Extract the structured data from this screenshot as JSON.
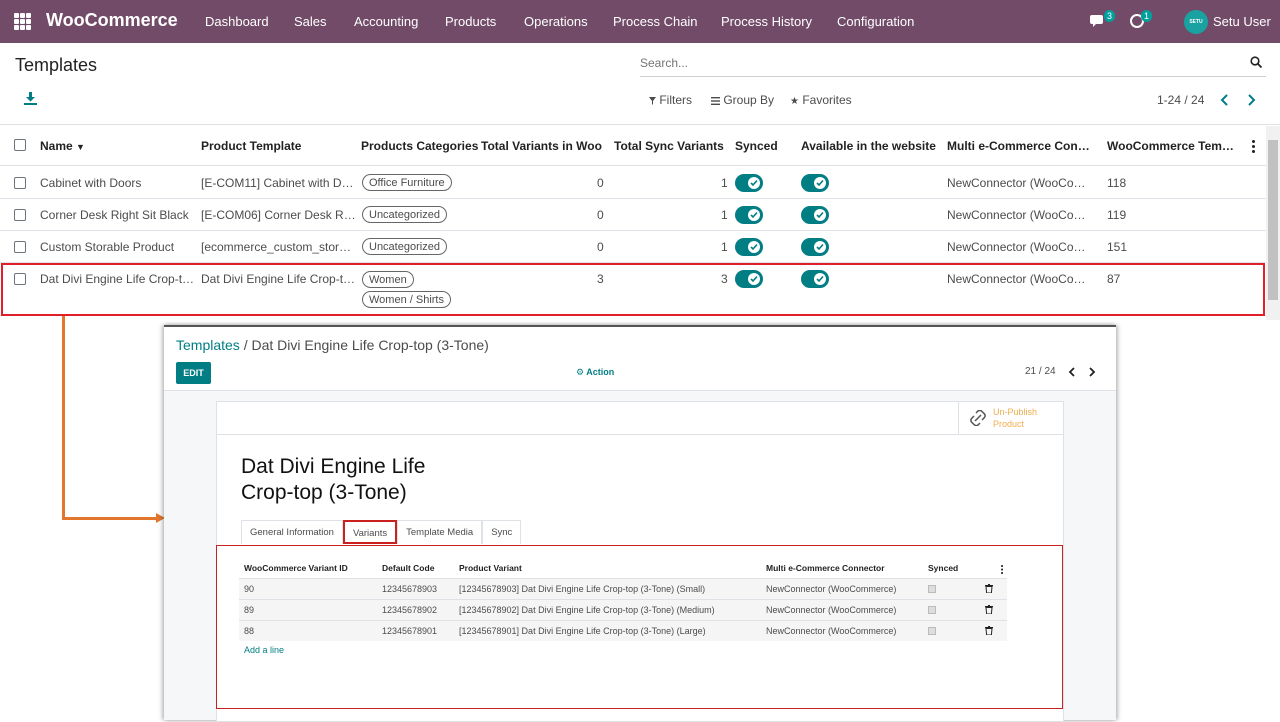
{
  "navbar": {
    "brand": "WooCommerce",
    "menu": [
      "Dashboard",
      "Sales",
      "Accounting",
      "Products",
      "Operations",
      "Process Chain",
      "Process History",
      "Configuration"
    ],
    "chat_count": "3",
    "activity_count": "1",
    "avatar_text": "SETU",
    "user_name": "Setu User"
  },
  "control_panel": {
    "title": "Templates",
    "search_placeholder": "Search...",
    "filters_label": "Filters",
    "group_by_label": "Group By",
    "favorites_label": "Favorites",
    "pager": "1-24 / 24"
  },
  "list": {
    "columns": [
      "Name",
      "Product Template",
      "Products Categories",
      "Total Variants in Woo",
      "Total Sync Variants",
      "Synced",
      "Available in the website",
      "Multi e-Commerce Conn…",
      "WooCommerce Temp…"
    ],
    "rows": [
      {
        "name": "Cabinet with Doors",
        "template": "[E-COM11] Cabinet with D…",
        "categories": [
          "Office Furniture"
        ],
        "total_variants": "0",
        "sync_variants": "1",
        "connector": "NewConnector (WooCom…",
        "woo_id": "118"
      },
      {
        "name": "Corner Desk Right Sit Black",
        "template": "[E-COM06] Corner Desk Ri…",
        "categories": [
          "Uncategorized"
        ],
        "total_variants": "0",
        "sync_variants": "1",
        "connector": "NewConnector (WooCom…",
        "woo_id": "119"
      },
      {
        "name": "Custom Storable Product",
        "template": "[ecommerce_custom_stor…",
        "categories": [
          "Uncategorized"
        ],
        "total_variants": "0",
        "sync_variants": "1",
        "connector": "NewConnector (WooCom…",
        "woo_id": "151"
      },
      {
        "name": "Dat Divi Engine Life Crop-t…",
        "template": "Dat Divi Engine Life Crop-t…",
        "categories": [
          "Women",
          "Women / Shirts"
        ],
        "total_variants": "3",
        "sync_variants": "3",
        "connector": "NewConnector (WooCom…",
        "woo_id": "87"
      }
    ]
  },
  "form": {
    "breadcrumb_parent": "Templates",
    "breadcrumb_sep": " / ",
    "breadcrumb_current": "Dat Divi Engine Life Crop-top (3-Tone)",
    "edit_label": "EDIT",
    "action_label": "Action",
    "pager": "21 / 24",
    "unpublish_label": "Un-Publish Product",
    "title_line1": "Dat Divi Engine Life",
    "title_line2": "Crop-top (3-Tone)",
    "tabs": [
      "General Information",
      "Variants",
      "Template Media",
      "Sync"
    ],
    "variant_columns": [
      "WooCommerce Variant ID",
      "Default Code",
      "Product Variant",
      "Multi e-Commerce Connector",
      "Synced"
    ],
    "variants": [
      {
        "id": "90",
        "code": "12345678903",
        "variant": "[12345678903] Dat Divi Engine Life Crop-top (3-Tone) (Small)",
        "connector": "NewConnector (WooCommerce)"
      },
      {
        "id": "89",
        "code": "12345678902",
        "variant": "[12345678902] Dat Divi Engine Life Crop-top (3-Tone) (Medium)",
        "connector": "NewConnector (WooCommerce)"
      },
      {
        "id": "88",
        "code": "12345678901",
        "variant": "[12345678901] Dat Divi Engine Life Crop-top (3-Tone) (Large)",
        "connector": "NewConnector (WooCommerce)"
      }
    ],
    "add_line": "Add a line"
  },
  "colors": {
    "navbar": "#714b67",
    "accent": "#017e84",
    "highlight": "#e01f2a",
    "connector_arrow": "#e2762d",
    "unpublish": "#f0ad4e"
  }
}
